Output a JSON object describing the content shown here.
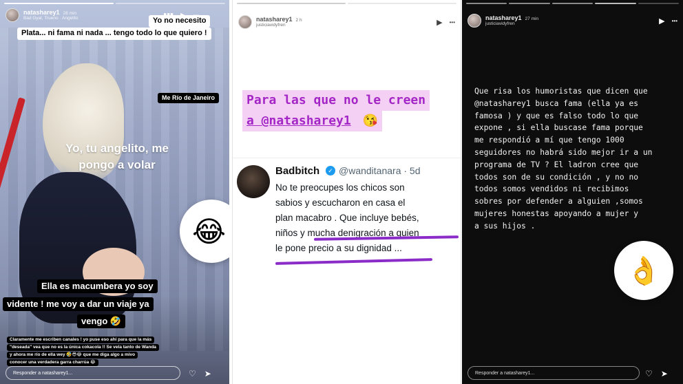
{
  "panels": {
    "p1": {
      "username": "natasharey1",
      "time": "28 min",
      "music": "Bad Gyal, Trueno · Angelito",
      "top_bubble_line1": "Yo no necesito",
      "top_bubble_line2": "Plata... ni fama ni nada ... tengo todo lo que quiero !",
      "location_tag": "Me Río de Janeiro",
      "center_text_line1": "Yo, tu angelito, me",
      "center_text_line2": "pongo a volar",
      "emoji": "😂",
      "caption_line1": "Ella es macumbera yo soy",
      "caption_line2": "vidente ! me voy a dar un viaje ya",
      "caption_line3": "vengo 🤣",
      "small_text_line1": "Claramente me escriben canales ! yo puse eso ahí para que la más",
      "small_text_line2": "\"deseada\" vea que no es la única cokacola !! Se vela tanto de Wanda",
      "small_text_line3": "y ahora me río de ella wey 🤣😎😂 que me diga algo a mivo",
      "small_text_line4": "conocer una verdadera garra charrúa 😂",
      "reply_placeholder": "Responder a natasharey1...",
      "like_icon": "♡",
      "send_icon": "➤"
    },
    "p2": {
      "username": "natasharey1",
      "time": "2 h",
      "sub": "justiciavidyfren",
      "play_icon": "▶",
      "more_icon": "•••",
      "title_line1": "Para las que no le creen",
      "title_line2": "a @natasharey1",
      "title_emoji": "😘",
      "tweet_name": "Badbitch",
      "tweet_handle": "@wanditanara · 5d",
      "tweet_line1": "No te preocupes los chicos son",
      "tweet_line2": "sabios y escucharon en casa el",
      "tweet_line3": "plan macabro . Que incluye bebés,",
      "tweet_line4": "niños y mucha denigración a quien",
      "tweet_line5": "le pone precio a su dignidad ..."
    },
    "p3": {
      "username": "natasharey1",
      "time": "27 min",
      "sub": "justiciavidyfren",
      "play_icon": "▶",
      "more_icon": "•••",
      "body_lines": [
        "Que risa los humoristas que dicen que",
        "@natasharey1 busca fama (ella ya es",
        "famosa ) y que es falso todo lo que",
        "expone , si ella buscase fama porque",
        "me respondió a mí que tengo 1000",
        "seguidores no habrá sido mejor ir a un",
        "programa de TV ? El ladron cree que",
        "todos son de su condición , y no no",
        "todos somos vendidos ni recibimos",
        "sobres por defender a alguien ,somos",
        "mujeres honestas apoyando a mujer y",
        "a sus hijos ."
      ],
      "emoji": "👌",
      "reply_placeholder": "Responder a natasharey1...",
      "like_icon": "♡",
      "send_icon": "➤"
    }
  },
  "colors": {
    "accent_purple": "#a426c6",
    "highlight_pink": "#f4d1f4",
    "underline_purple": "#8b2cc9",
    "verified_blue": "#1d9bf0"
  }
}
